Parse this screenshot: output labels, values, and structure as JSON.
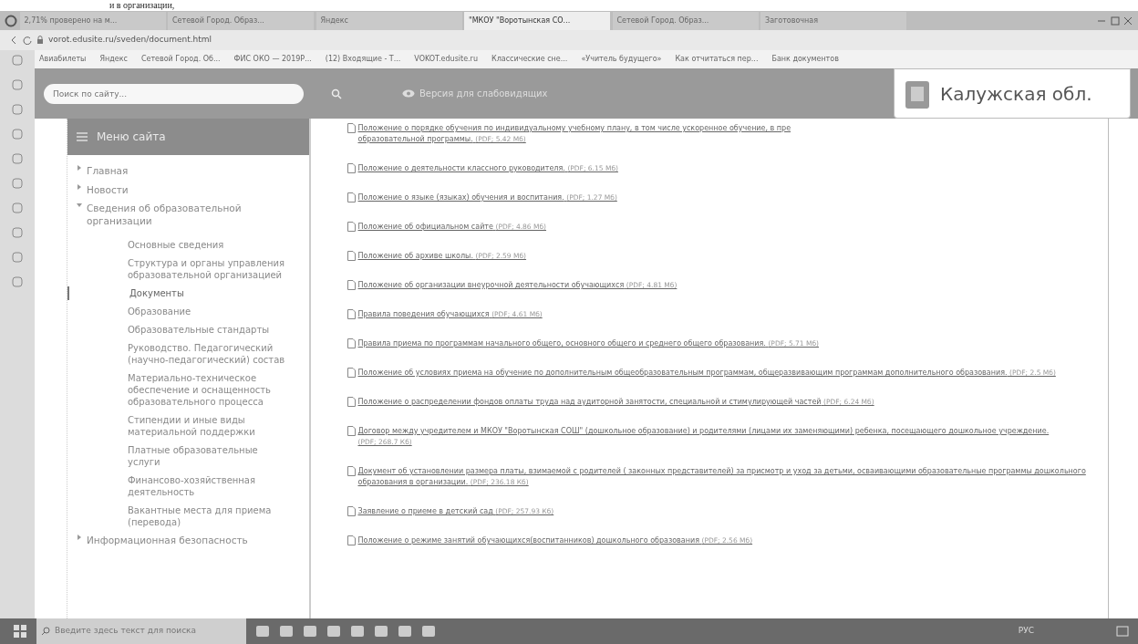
{
  "printed_caption": "и в организации,",
  "browser": {
    "tabs": [
      {
        "label": "2,71% проверено на м...",
        "selected": false
      },
      {
        "label": "Сетевой Город. Образ...",
        "selected": false
      },
      {
        "label": "Яндекс",
        "selected": false
      },
      {
        "label": "\"МКОУ \"Воротынская СО...",
        "selected": true
      },
      {
        "label": "Сетевой Город. Образ...",
        "selected": false
      },
      {
        "label": "Заготовочная",
        "selected": false
      }
    ],
    "address": "vorot.edusite.ru/sveden/document.html",
    "bookmarks": [
      "Авиабилеты",
      "Яндекс",
      "Сетевой Город. Об...",
      "ФИС ОКО — 2019Р...",
      "(12) Входящие - Т...",
      "VOKOT.edusite.ru",
      "Классические сне...",
      "«Учитель будущего»",
      "Как отчитаться пер...",
      "Банк документов"
    ]
  },
  "site": {
    "search": {
      "placeholder": "Поиск по сайту..."
    },
    "accessibility_link": "Версия для слабовидящих",
    "region_badge": "Калужская обл.",
    "menu": {
      "title": "Меню сайта",
      "items": [
        {
          "label": "Главная",
          "expanded": false
        },
        {
          "label": "Новости",
          "expanded": false
        },
        {
          "label": "Сведения об образовательной организации",
          "expanded": true,
          "children": [
            {
              "label": "Основные сведения",
              "selected": false
            },
            {
              "label": "Структура и органы управления образовательной организацией",
              "selected": false
            },
            {
              "label": "Документы",
              "selected": true
            },
            {
              "label": "Образование",
              "selected": false
            },
            {
              "label": "Образовательные стандарты",
              "selected": false
            },
            {
              "label": "Руководство. Педагогический (научно-педагогический) состав",
              "selected": false
            },
            {
              "label": "Материально-техническое обеспечение и оснащенность образовательного процесса",
              "selected": false
            },
            {
              "label": "Стипендии и иные виды материальной поддержки",
              "selected": false
            },
            {
              "label": "Платные образовательные услуги",
              "selected": false
            },
            {
              "label": "Финансово-хозяйственная деятельность",
              "selected": false
            },
            {
              "label": "Вакантные места для приема (перевода)",
              "selected": false
            }
          ]
        },
        {
          "label": "Информационная безопасность",
          "expanded": false
        }
      ]
    },
    "documents": [
      {
        "title": "Положение о порядке обучения по индивидуальному учебному плану, в том числе ускоренное обучение, в пре",
        "continuation": "образовательной программы.",
        "size": "(PDF; 5.42 Мб)"
      },
      {
        "title": "Положение о деятельности классного руководителя.",
        "size": "(PDF; 6.15 Мб)"
      },
      {
        "title": "Положение о языке (языках) обучения и воспитания.",
        "size": "(PDF; 1.27 Мб)"
      },
      {
        "title": "Положение об официальном сайте",
        "size": "(PDF; 4.86 Мб)"
      },
      {
        "title": "Положение об архиве школы.",
        "size": "(PDF; 2.59 Мб)"
      },
      {
        "title": "Положение об организации внеурочной деятельности обучающихся",
        "size": "(PDF; 4.81 Мб)"
      },
      {
        "title": "Правила поведения обучающихся",
        "size": "(PDF; 4.61 Мб)"
      },
      {
        "title": "Правила приема по программам начального общего, основного общего и среднего общего образования.",
        "size": "(PDF; 5.71 Мб)"
      },
      {
        "title": "Положение об условиях приема на обучение по дополнительным общеобразовательным программам, общеразвивающим программам дополнительного образования.",
        "size": "(PDF; 2.5 Мб)"
      },
      {
        "title": "Положение о распределении фондов оплаты труда над аудиторной занятости, специальной и стимулирующей частей",
        "size": "(PDF; 6.24 Мб)"
      },
      {
        "title": "Договор между учредителем и МКОУ \"Воротынская СОШ\" (дошкольное образование) и родителями (лицами их заменяющими) ребенка, посещающего дошкольное учреждение.",
        "size": "(PDF; 268.7 Кб)"
      },
      {
        "title": "Документ об установлении размера платы, взимаемой с родителей ( законных представителей) за присмотр и уход за детьми, осваивающими образовательные программы дошкольного образования в организации.",
        "size": "(PDF; 236.18 Кб)"
      },
      {
        "title": "Заявление о приеме в детский сад",
        "size": "(PDF; 257.93 Кб)"
      },
      {
        "title": "Положение о режиме занятий обучающихся(воспитанников) дошкольного образования",
        "size": "(PDF; 2.56 Мб)"
      }
    ]
  },
  "taskbar": {
    "search_placeholder": "Введите здесь текст для поиска",
    "language": "РУС"
  }
}
